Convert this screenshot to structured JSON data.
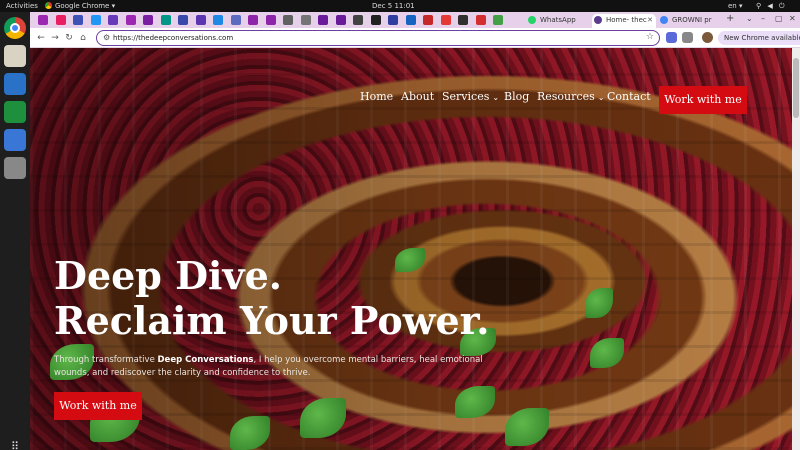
{
  "system": {
    "activities": "Activities",
    "app_name": "Google Chrome ▾",
    "clock": "Dec 5  11:01",
    "lang": "en ▾",
    "tray": "⚲ ◀ ⏻"
  },
  "browser": {
    "tabs": [
      {
        "label": "WhatsApp",
        "fav_color": "#25d366"
      },
      {
        "label": "Home- thec",
        "fav_color": "#5a3b8c",
        "active": true
      },
      {
        "label": "GROWNI pr",
        "fav_color": "#4285f4"
      }
    ],
    "pinned_fav_colors": [
      "#9c27b0",
      "#e91e63",
      "#3f51b5",
      "#2196f3",
      "#673ab7",
      "#9c27b0",
      "#7b1fa2",
      "#009688",
      "#3949ab",
      "#5e35b1",
      "#1e88e5",
      "#5c6bc0",
      "#8e24aa",
      "#8e24aa",
      "#616161",
      "#757575",
      "#6a1b9a",
      "#6a1b9a",
      "#424242",
      "#212121",
      "#303f9f",
      "#1565c0",
      "#c62828",
      "#e53935",
      "#303030",
      "#d32f2f",
      "#43a047"
    ],
    "new_tab": "+",
    "window_controls": [
      "⌄",
      "–",
      "▢",
      "✕"
    ],
    "url": "https://thedeepconversations.com",
    "update_label": "New Chrome available",
    "update_more": "⋮"
  },
  "site": {
    "nav": [
      {
        "label": "Home"
      },
      {
        "label": "About"
      },
      {
        "label": "Services",
        "chevron": "⌄"
      },
      {
        "label": "Blog"
      },
      {
        "label": "Resources",
        "chevron": "⌄"
      },
      {
        "label": "Contact"
      }
    ],
    "nav_cta": "Work with me",
    "hero_title_line1": "Deep Dive.",
    "hero_title_line2": "Reclaim Your Power.",
    "hero_sub_pre": "Through transformative ",
    "hero_sub_bold": "Deep Conversations",
    "hero_sub_post": ", I help you overcome mental barriers, heal emotional wounds, and rediscover the clarity and confidence to thrive.",
    "hero_cta": "Work with me"
  }
}
